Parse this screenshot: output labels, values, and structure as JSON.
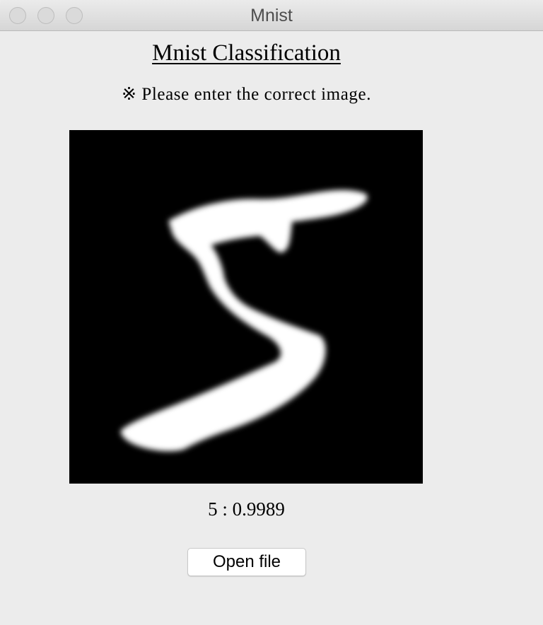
{
  "window": {
    "title": "Mnist"
  },
  "app": {
    "heading": "Mnist Classification",
    "notice": "※ Please enter the correct image."
  },
  "image": {
    "content": "digit-5-image"
  },
  "prediction": {
    "text": "5 : 0.9989"
  },
  "actions": {
    "open_file_label": "Open file"
  }
}
